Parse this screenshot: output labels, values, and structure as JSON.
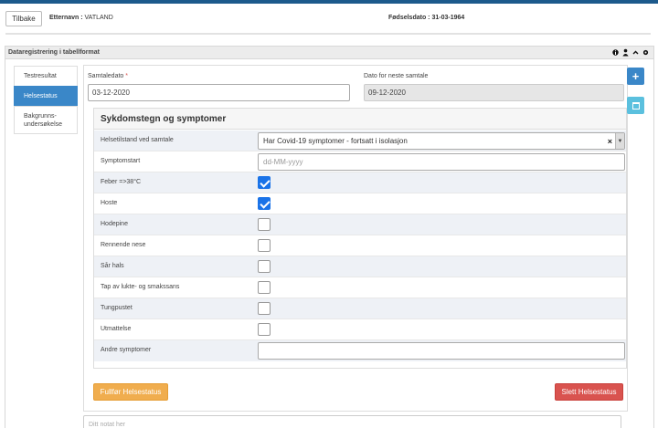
{
  "header": {
    "back_label": "Tilbake",
    "surname_label": "Etternavn :",
    "surname_value": "VATLAND",
    "dob_label": "Fødselsdato :",
    "dob_value": "31-03-1964"
  },
  "panel": {
    "title": "Dataregistrering i tabellformat",
    "icons": [
      "info-icon",
      "user-icon",
      "chevron-up-icon",
      "gear-icon"
    ]
  },
  "sidebar": {
    "items": [
      {
        "label": "Testresultat",
        "active": false
      },
      {
        "label": "Helsestatus",
        "active": true
      },
      {
        "label": "Bakgrunns-\nundersøkelse",
        "active": false
      }
    ]
  },
  "form": {
    "samtaledato_label": "Samtaledato",
    "samtaledato_required": "*",
    "samtaledato_value": "03-12-2020",
    "neste_label": "Dato for neste samtale",
    "neste_value": "09-12-2020"
  },
  "section": {
    "title": "Sykdomstegn og symptomer",
    "helsetilstand_label": "Helsetilstand ved samtale",
    "helsetilstand_value": "Har Covid-19 symptomer - fortsatt i isolasjon",
    "symptomstart_label": "Symptomstart",
    "symptomstart_placeholder": "dd-MM-yyyy",
    "symptoms": [
      {
        "label": "Feber =>38°C",
        "checked": true
      },
      {
        "label": "Hoste",
        "checked": true
      },
      {
        "label": "Hodepine",
        "checked": false
      },
      {
        "label": "Rennende nese",
        "checked": false
      },
      {
        "label": "Sår hals",
        "checked": false
      },
      {
        "label": "Tap av lukte- og smakssans",
        "checked": false
      },
      {
        "label": "Tungpustet",
        "checked": false
      },
      {
        "label": "Utmattelse",
        "checked": false
      }
    ],
    "andre_label": "Andre symptomer"
  },
  "actions": {
    "complete_label": "Fullfør Helsestatus",
    "delete_label": "Slett Helsestatus"
  },
  "note": {
    "placeholder": "Ditt notat her"
  },
  "colors": {
    "primary": "#3a87c8",
    "warning": "#f0ad4e",
    "danger": "#d9534f",
    "info": "#5bc0de",
    "topbar": "#1d5a8c"
  }
}
